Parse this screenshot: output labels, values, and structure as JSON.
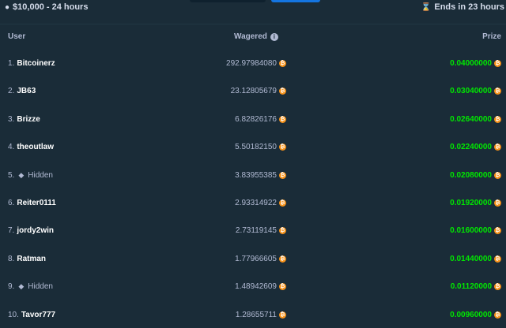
{
  "header": {
    "prize_pool": "$10,000 - 24 hours",
    "ends_in": "Ends in 23 hours"
  },
  "table": {
    "col_user": "User",
    "col_wagered": "Wagered",
    "col_prize": "Prize",
    "rows": [
      {
        "rank": "1.",
        "user": "Bitcoinerz",
        "wagered": "292.97984080",
        "prize": "0.04000000"
      },
      {
        "rank": "2.",
        "user": "JB63",
        "wagered": "23.12805679",
        "prize": "0.03040000"
      },
      {
        "rank": "3.",
        "user": "Brizze",
        "wagered": "6.82826176",
        "prize": "0.02640000"
      },
      {
        "rank": "4.",
        "user": "theoutlaw",
        "wagered": "5.50182150",
        "prize": "0.02240000"
      },
      {
        "rank": "5.",
        "user": "Hidden",
        "wagered": "3.83955385",
        "prize": "0.02080000"
      },
      {
        "rank": "6.",
        "user": "Reiter0111",
        "wagered": "2.93314922",
        "prize": "0.01920000"
      },
      {
        "rank": "7.",
        "user": "jordy2win",
        "wagered": "2.73119145",
        "prize": "0.01600000"
      },
      {
        "rank": "8.",
        "user": "Ratman",
        "wagered": "1.77966605",
        "prize": "0.01440000"
      },
      {
        "rank": "9.",
        "user": "Hidden",
        "wagered": "1.48942609",
        "prize": "0.01120000"
      },
      {
        "rank": "10.",
        "user": "Tavor777",
        "wagered": "1.28655711",
        "prize": "0.00960000"
      }
    ]
  },
  "colors": {
    "background": "#1a2c38",
    "prize_green": "#00e701",
    "btc_orange": "#f7931a"
  }
}
